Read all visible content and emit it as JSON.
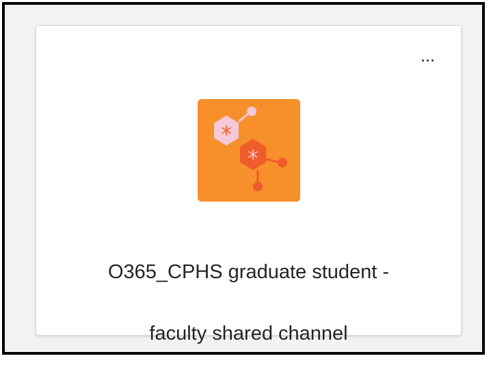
{
  "team_card": {
    "more_options_label": "...",
    "icon": "molecule-team-icon",
    "name_line1": "O365_CPHS graduate student -",
    "name_line2": "faculty shared channel"
  },
  "colors": {
    "icon_background": "#f7902a",
    "hexagon_light": "#f7c9d6",
    "hexagon_dark": "#ef5b2a"
  }
}
